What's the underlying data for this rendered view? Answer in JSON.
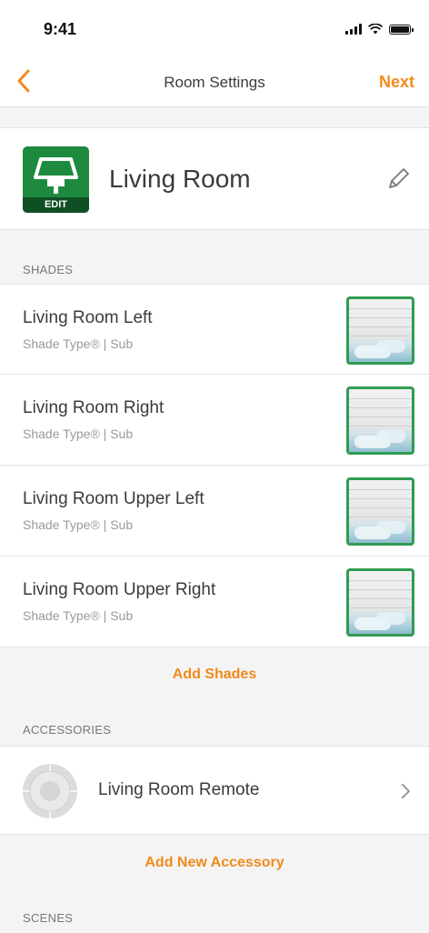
{
  "status_bar": {
    "time": "9:41"
  },
  "nav": {
    "back_icon": "chevron-left-icon",
    "title": "Room Settings",
    "next_label": "Next"
  },
  "room": {
    "name": "Living Room",
    "icon_badge": "EDIT",
    "icon": "lamp-icon",
    "edit_icon": "pencil-icon"
  },
  "shades": {
    "section_label": "SHADES",
    "items": [
      {
        "name": "Living Room Left",
        "type": "Shade Type® | Sub"
      },
      {
        "name": "Living Room Right",
        "type": "Shade Type® | Sub"
      },
      {
        "name": "Living Room Upper Left",
        "type": "Shade Type® | Sub"
      },
      {
        "name": "Living Room Upper Right",
        "type": "Shade Type® | Sub"
      }
    ],
    "add_label": "Add Shades"
  },
  "accessories": {
    "section_label": "ACCESSORIES",
    "items": [
      {
        "name": "Living Room Remote",
        "icon": "remote-icon"
      }
    ],
    "add_label": "Add New Accessory"
  },
  "scenes": {
    "section_label": "SCENES"
  },
  "colors": {
    "accent": "#f08a1c",
    "green": "#2f9c52"
  }
}
